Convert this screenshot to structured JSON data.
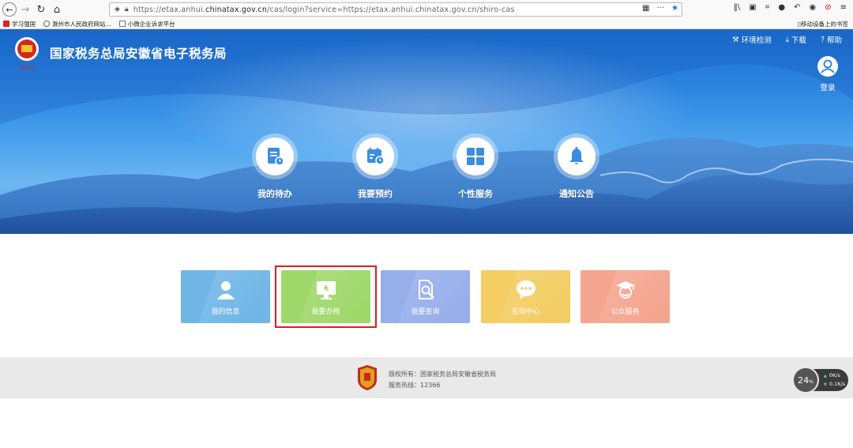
{
  "browser": {
    "url_prefix": "https://etax.anhui.",
    "url_domain": "chinatax.gov.cn",
    "url_suffix": "/cas/login?service=https://etax.anhui.chinatax.gov.cn/shiro-cas",
    "bookmarks": [
      "学习强国",
      "滁州市人民政府网站...",
      "小微企业诉求平台"
    ],
    "mobile_bookmarks": "移动设备上的书签"
  },
  "header": {
    "site_title": "国家税务总局安徽省电子税务局",
    "links": {
      "env_check": "环境检测",
      "download": "下载",
      "help": "帮助"
    },
    "login": "登录"
  },
  "features": [
    {
      "label": "我的待办",
      "icon": "todo-document-icon"
    },
    {
      "label": "我要预约",
      "icon": "calendar-clock-icon"
    },
    {
      "label": "个性服务",
      "icon": "grid-apps-icon"
    },
    {
      "label": "通知公告",
      "icon": "bell-icon"
    }
  ],
  "tiles": [
    {
      "label": "我的信息",
      "color": "#6fb6e6",
      "icon": "user-icon"
    },
    {
      "label": "我要办税",
      "color": "#9ed86a",
      "icon": "monitor-cursor-icon"
    },
    {
      "label": "我要查询",
      "color": "#96aeea",
      "icon": "document-search-icon"
    },
    {
      "label": "互动中心",
      "color": "#f3cd63",
      "icon": "chat-bubble-icon"
    },
    {
      "label": "公众服务",
      "color": "#f4a58f",
      "icon": "student-cap-icon"
    }
  ],
  "highlight_color": "#d81e1e",
  "footer": {
    "copyright": "版权所有：国家税务总局安徽省税务局",
    "hotline": "服务热线：12366"
  },
  "speed_widget": {
    "percent": "24",
    "unit": "%",
    "up": "0K/s",
    "down": "0.1K/s"
  }
}
